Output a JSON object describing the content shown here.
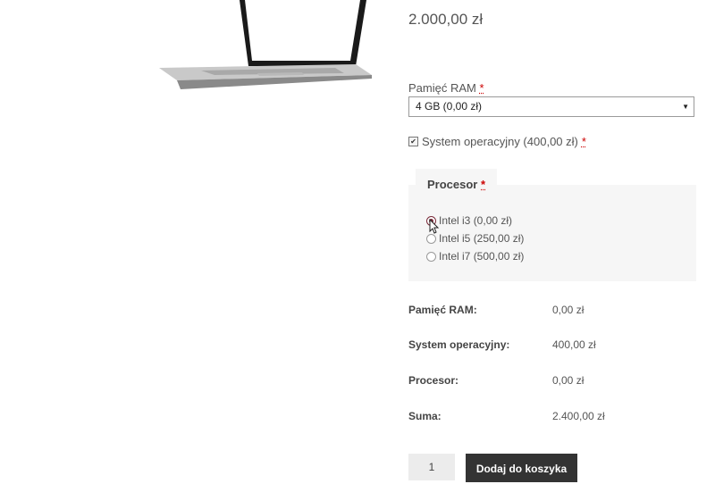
{
  "product": {
    "price": "2.000,00 zł",
    "image_icon": "laptop-icon"
  },
  "ram": {
    "label": "Pamięć RAM",
    "required_mark": "*",
    "selected": "4 GB (0,00 zł)"
  },
  "os": {
    "label": "System operacyjny (400,00 zł)",
    "required_mark": "*",
    "checked": true
  },
  "processor": {
    "label": "Procesor",
    "required_mark": "*",
    "options": [
      {
        "label": "Intel i3 (0,00 zł)",
        "selected": true
      },
      {
        "label": "Intel i5 (250,00 zł)",
        "selected": false
      },
      {
        "label": "Intel i7 (500,00 zł)",
        "selected": false
      }
    ]
  },
  "summary": [
    {
      "label": "Pamięć RAM:",
      "value": "0,00 zł"
    },
    {
      "label": "System operacyjny:",
      "value": "400,00 zł"
    },
    {
      "label": "Procesor:",
      "value": "0,00 zł"
    },
    {
      "label": "Suma:",
      "value": "2.400,00 zł"
    }
  ],
  "cart": {
    "quantity": "1",
    "add_label": "Dodaj do koszyka"
  },
  "colors": {
    "accent": "#7a2c3a",
    "button_bg": "#333333"
  }
}
